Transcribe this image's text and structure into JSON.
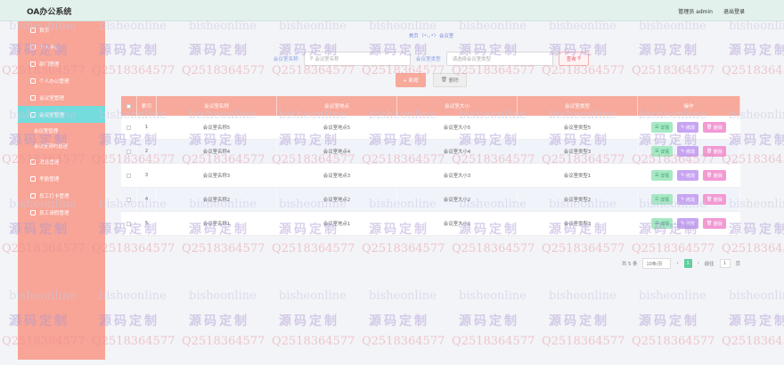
{
  "header": {
    "title": "OA办公系统",
    "user": "管理员 admin",
    "logout": "退出登录"
  },
  "sidebar": {
    "items": [
      {
        "label": "首页",
        "icon": "home-icon"
      },
      {
        "label": "个人中心",
        "icon": "user-icon"
      },
      {
        "label": "部门管理",
        "icon": "dept-icon"
      },
      {
        "label": "个人办公管理",
        "icon": "office-icon"
      },
      {
        "label": "会议室管理",
        "icon": "room-icon"
      },
      {
        "label": "会议室管理",
        "icon": "room-icon",
        "active": true
      }
    ],
    "subs": [
      "会议室管理",
      "会议室预约管理"
    ],
    "more": [
      {
        "label": "消息管理",
        "icon": "message-icon"
      },
      {
        "label": "考勤管理",
        "icon": "attendance-icon"
      },
      {
        "label": "员工打卡管理",
        "icon": "clock-icon"
      },
      {
        "label": "员工请假管理",
        "icon": "leave-icon"
      }
    ]
  },
  "breadcrumb": {
    "home": "首页",
    "face": "(•◡•)",
    "current": "会议室"
  },
  "search": {
    "name_label": "会议室名称",
    "name_placeholder": "会议室名称",
    "type_label": "会议室类型",
    "type_placeholder": "请选择会议室类型",
    "search_btn": "查询"
  },
  "actions": {
    "add": "+ 新增",
    "delete": "删除"
  },
  "table": {
    "columns": [
      "索引",
      "会议室名称",
      "会议室地点",
      "会议室大小",
      "会议室类型",
      "操作"
    ],
    "rows": [
      {
        "idx": "1",
        "name": "会议室名称5",
        "place": "会议室地点5",
        "size": "会议室大小5",
        "type": "会议室类型5"
      },
      {
        "idx": "2",
        "name": "会议室名称4",
        "place": "会议室地点4",
        "size": "会议室大小4",
        "type": "会议室类型3"
      },
      {
        "idx": "3",
        "name": "会议室名称3",
        "place": "会议室地点3",
        "size": "会议室大小3",
        "type": "会议室类型1"
      },
      {
        "idx": "4",
        "name": "会议室名称2",
        "place": "会议室地点2",
        "size": "会议室大小2",
        "type": "会议室类型2"
      },
      {
        "idx": "5",
        "name": "会议室名称1",
        "place": "会议室地点1",
        "size": "会议室大小1",
        "type": "会议室类型3"
      }
    ],
    "op_detail": "详情",
    "op_edit": "修改",
    "op_delete": "删除"
  },
  "pager": {
    "total": "共 5 条",
    "size": "10条/页",
    "current": "1",
    "goto": "前往",
    "page": "1",
    "unit": "页"
  },
  "watermark": {
    "en": "bisheonline",
    "cn": "源码定制",
    "qq": "Q2518364577"
  }
}
